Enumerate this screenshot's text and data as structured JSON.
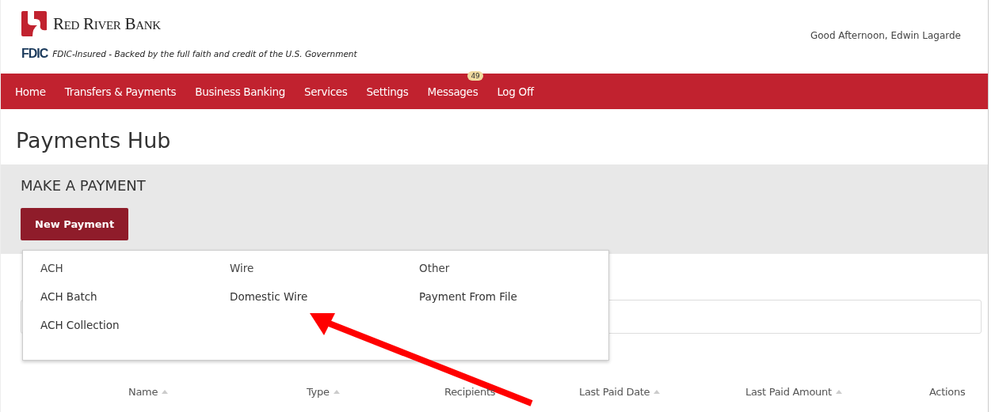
{
  "bank": {
    "name": "Red River Bank",
    "fdic": "FDIC",
    "fdic_text": "FDIC-Insured - Backed by the full faith and credit of the U.S. Government"
  },
  "greeting": "Good Afternoon, Edwin Lagarde",
  "nav": [
    {
      "label": "Home"
    },
    {
      "label": "Transfers & Payments"
    },
    {
      "label": "Business Banking"
    },
    {
      "label": "Services"
    },
    {
      "label": "Settings"
    },
    {
      "label": "Messages",
      "badge": "49"
    },
    {
      "label": "Log Off"
    }
  ],
  "page_title": "Payments Hub",
  "section_title": "MAKE A PAYMENT",
  "new_payment_button": "New Payment",
  "dropdown": {
    "columns": [
      {
        "heading": "ACH",
        "items": [
          "ACH Batch",
          "ACH Collection"
        ]
      },
      {
        "heading": "Wire",
        "items": [
          "Domestic Wire"
        ]
      },
      {
        "heading": "Other",
        "items": [
          "Payment From File"
        ]
      }
    ]
  },
  "table": {
    "columns": [
      {
        "label": "Name",
        "sortable": true
      },
      {
        "label": "Type",
        "sortable": true
      },
      {
        "label": "Recipients",
        "sortable": false
      },
      {
        "label": "Last Paid Date",
        "sortable": true
      },
      {
        "label": "Last Paid Amount",
        "sortable": true
      },
      {
        "label": "Actions",
        "sortable": false
      }
    ]
  }
}
